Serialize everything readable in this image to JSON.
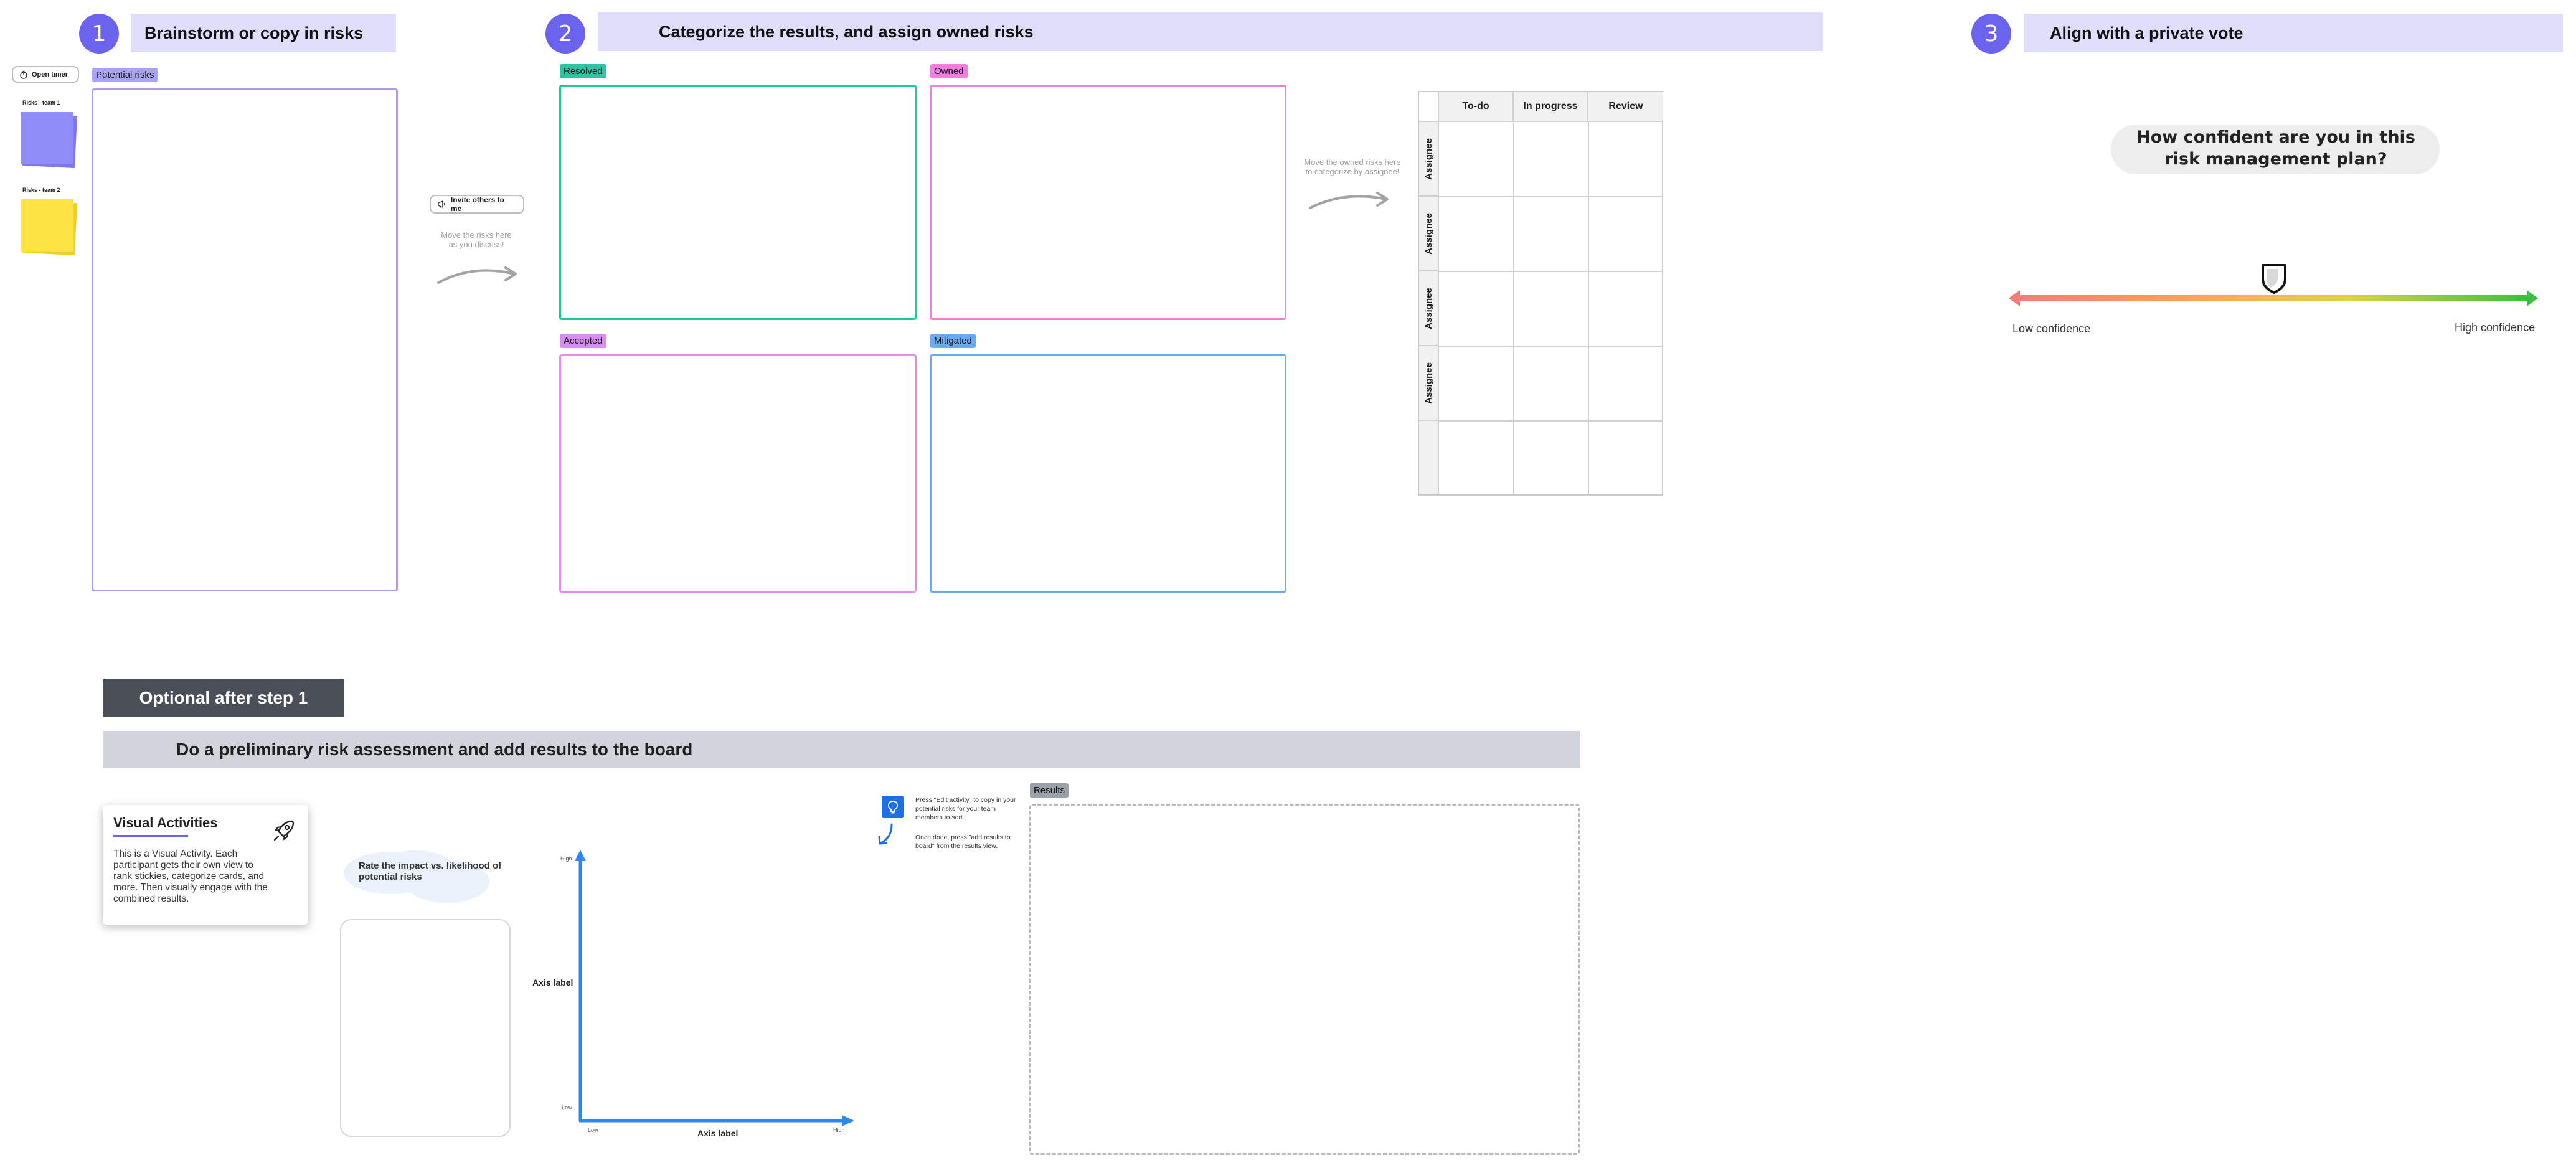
{
  "steps": [
    {
      "number": "1",
      "title": "Brainstorm or copy in risks"
    },
    {
      "number": "2",
      "title": "Categorize the results, and assign owned risks"
    },
    {
      "number": "3",
      "title": "Align with a private vote"
    }
  ],
  "timer_button": "Open timer",
  "stickies": [
    {
      "label": "Risks - team 1",
      "color": "#8f8bf7"
    },
    {
      "label": "Risks - team 2",
      "color": "#fde244"
    }
  ],
  "potential_risks_tag": "Potential risks",
  "invite_button": "Invite others to me",
  "hint_move_risks": "Move the risks here as you discuss!",
  "hint_move_owned": "Move the owned risks here to categorize by assignee!",
  "categories": [
    {
      "label": "Resolved",
      "tag_color": "#2ec4a4",
      "border": "#22c59e"
    },
    {
      "label": "Owned",
      "tag_color": "#f07de0",
      "border": "#f07de0"
    },
    {
      "label": "Accepted",
      "tag_color": "#d98cf0",
      "border": "#e58ce9"
    },
    {
      "label": "Mitigated",
      "tag_color": "#6aaaf0",
      "border": "#6aaaf0"
    }
  ],
  "kanban": {
    "columns": [
      "To-do",
      "In progress",
      "Review"
    ],
    "rows": [
      "Assignee",
      "Assignee",
      "Assignee",
      "Assignee",
      ""
    ]
  },
  "vote": {
    "question": "How confident are you in this risk management plan?",
    "low_label": "Low confidence",
    "high_label": "High confidence",
    "marker_position": 0.5
  },
  "optional": {
    "button": "Optional after step 1",
    "bar": "Do a preliminary risk assessment and add results to the board"
  },
  "visual_activities": {
    "title": "Visual Activities",
    "body": "This is a Visual Activity. Each participant gets their own view to rank stickies, categorize cards, and more. Then visually engage with the combined results."
  },
  "rate_prompt": "Rate the impact vs. likelihood of potential risks",
  "axis": {
    "y_label": "Axis label",
    "x_label": "Axis label",
    "y_high": "High",
    "y_low": "Low",
    "x_low": "Low",
    "x_high": "High"
  },
  "tip": {
    "line1": "Press \"Edit activity\" to copy in your potential risks for your team members to sort.",
    "line2": "Once done, press \"add results to board\" from the results view."
  },
  "results_tag": "Results",
  "colors": {
    "accent": "#6b63ee",
    "step_bar": "#dedefb",
    "potential_border": "#a79bf0",
    "tip_icon": "#1f6fe0",
    "axis": "#2f86f0"
  }
}
